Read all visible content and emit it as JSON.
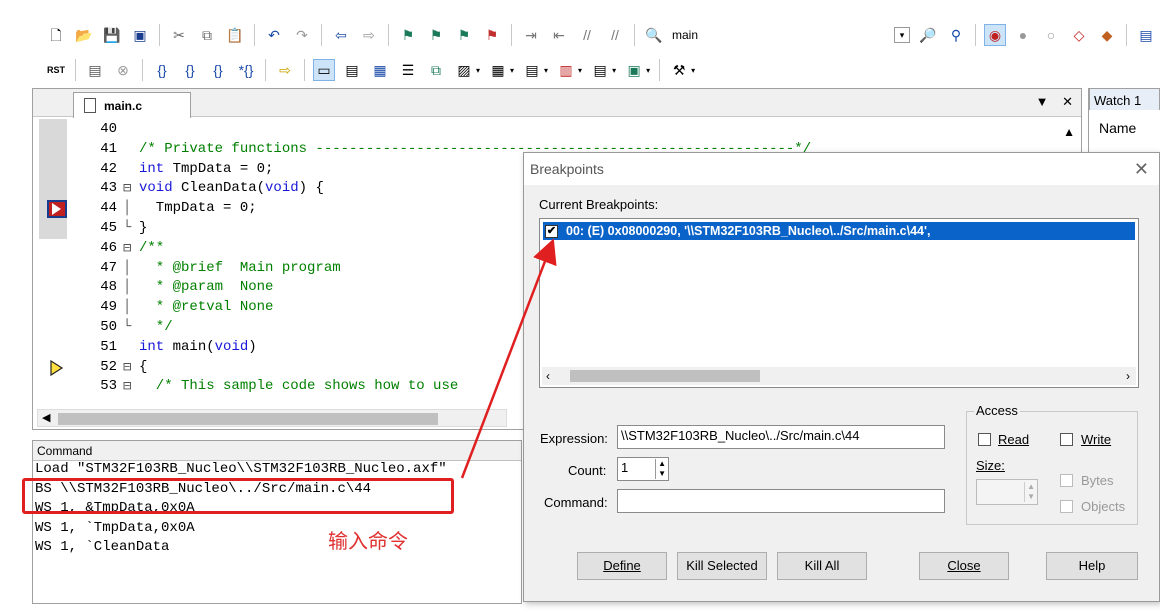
{
  "toolbar1": {
    "icons": [
      "new-file-icon",
      "open-folder-icon",
      "save-icon",
      "save-all-icon",
      "cut-icon",
      "copy-icon",
      "paste-icon",
      "undo-icon",
      "redo-icon",
      "nav-back-icon",
      "nav-forward-icon",
      "bookmark-icon",
      "bookmark-prev-icon",
      "bookmark-next-icon",
      "bookmark-clear-icon",
      "indent-icon",
      "unindent-icon",
      "comment-icon",
      "uncomment-icon",
      "find-in-files-icon"
    ],
    "target_label": "main"
  },
  "editor": {
    "tab_label": "main.c",
    "lines": [
      {
        "num": "40",
        "fold": "",
        "text": ""
      },
      {
        "num": "41",
        "fold": "",
        "text": "/* Private functions ---------------------------------------------------------*/",
        "cls": "cm"
      },
      {
        "num": "42",
        "fold": "",
        "text": "int TmpData = 0;",
        "cls": "mix1"
      },
      {
        "num": "43",
        "fold": "⊟",
        "text": "void CleanData(void) {",
        "cls": "mix2"
      },
      {
        "num": "44",
        "fold": "│",
        "text": "  TmpData = 0;"
      },
      {
        "num": "45",
        "fold": "└",
        "text": "}"
      },
      {
        "num": "46",
        "fold": "⊟",
        "text": "/**",
        "cls": "cm"
      },
      {
        "num": "47",
        "fold": "│",
        "text": "  * @brief  Main program",
        "cls": "cm"
      },
      {
        "num": "48",
        "fold": "│",
        "text": "  * @param  None",
        "cls": "cm"
      },
      {
        "num": "49",
        "fold": "│",
        "text": "  * @retval None",
        "cls": "cm"
      },
      {
        "num": "50",
        "fold": "└",
        "text": "  */",
        "cls": "cm"
      },
      {
        "num": "51",
        "fold": "",
        "text": "int main(void)",
        "cls": "mix3"
      },
      {
        "num": "52",
        "fold": "⊟",
        "text": "{"
      },
      {
        "num": "53",
        "fold": "⊟",
        "text": "  /* This sample code shows how to use",
        "cls": "cm"
      }
    ]
  },
  "command": {
    "title": "Command",
    "lines": [
      "Load \"STM32F103RB_Nucleo\\\\STM32F103RB_Nucleo.axf\"",
      "BS \\\\STM32F103RB_Nucleo\\../Src/main.c\\44",
      "WS 1, &TmpData,0x0A",
      "WS 1, `TmpData,0x0A",
      "WS 1, `CleanData"
    ],
    "annotation": "输入命令"
  },
  "watch": {
    "tab_label": "Watch 1",
    "col_name": "Name"
  },
  "dialog": {
    "title": "Breakpoints",
    "current_label": "Current Breakpoints:",
    "breakpoint_item": "00: (E) 0x08000290,  '\\\\STM32F103RB_Nucleo\\../Src/main.c\\44',",
    "expression_label": "Expression:",
    "expression_value": "\\\\STM32F103RB_Nucleo\\../Src/main.c\\44",
    "count_label": "Count:",
    "count_value": "1",
    "command_label": "Command:",
    "command_value": "",
    "access_label": "Access",
    "read_label": "Read",
    "write_label": "Write",
    "size_label": "Size:",
    "bytes_label": "Bytes",
    "objects_label": "Objects",
    "buttons": {
      "define": "Define",
      "kill_selected": "Kill Selected",
      "kill_all": "Kill All",
      "close": "Close",
      "help": "Help"
    }
  },
  "colors": {
    "highlight_red": "#e02020",
    "selection_blue": "#0a63c8",
    "keyword_blue": "#1818d8",
    "comment_green": "#008000"
  }
}
